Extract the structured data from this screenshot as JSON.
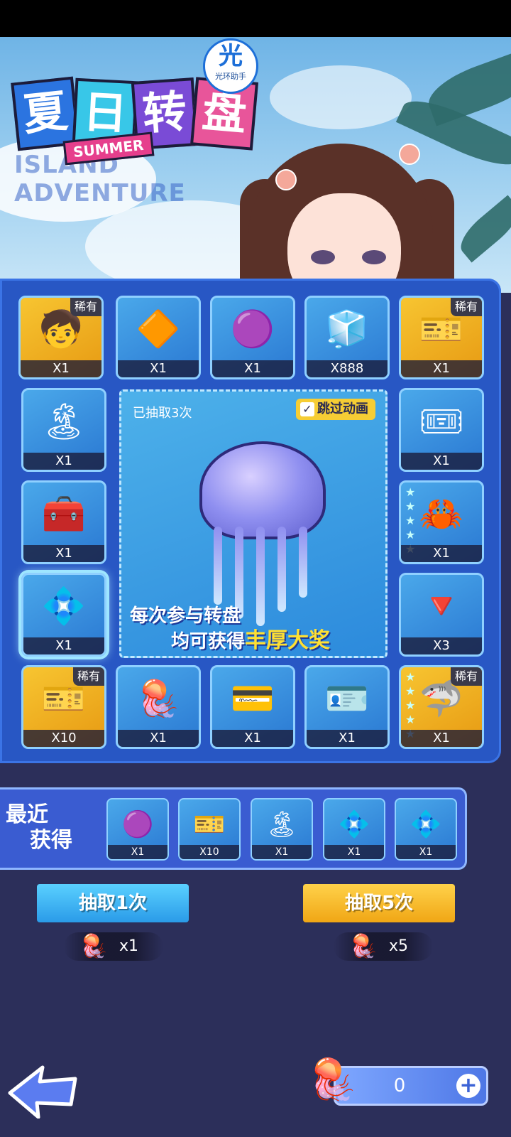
{
  "header": {
    "title_chars": [
      "夏",
      "日",
      "转",
      "盘"
    ],
    "summer_tag": "SUMMER",
    "subtitle": "ISLAND ADVENTURE",
    "helper": {
      "glyph": "光",
      "text": "光环助手"
    }
  },
  "board": {
    "draw_count_text": "已抽取3次",
    "skip_animation": {
      "label": "跳过动画",
      "checked": true,
      "check_mark": "✓"
    },
    "promo_line1": "每次参与转盘",
    "promo_line2_prefix": "均可获得",
    "promo_line2_highlight": "丰厚大奖",
    "rare_label": "稀有",
    "cells": [
      {
        "id": "r1c1",
        "name": "character-portrait",
        "icon": "🧒",
        "qty": "X1",
        "rare": true,
        "stars": 0
      },
      {
        "id": "r1c2",
        "name": "emblem-card",
        "icon": "🔶",
        "qty": "X1",
        "rare": false,
        "stars": 0
      },
      {
        "id": "r1c3",
        "name": "purple-hex-token",
        "icon": "🟣",
        "qty": "X1",
        "rare": false,
        "stars": 0
      },
      {
        "id": "r1c4",
        "name": "blue-cube",
        "icon": "🧊",
        "qty": "X888",
        "rare": false,
        "stars": 0
      },
      {
        "id": "r1c5",
        "name": "unique-ticket",
        "icon": "🎫",
        "qty": "X1",
        "rare": true,
        "stars": 0
      },
      {
        "id": "r2c1",
        "name": "beach-card",
        "icon": "🏝",
        "qty": "X1",
        "rare": false,
        "stars": 0
      },
      {
        "id": "r2c5",
        "name": "unique-ticket-red",
        "icon": "🎟",
        "qty": "X1",
        "rare": false,
        "stars": 0
      },
      {
        "id": "r3c1",
        "name": "red-chest",
        "icon": "🧰",
        "qty": "X1",
        "rare": false,
        "stars": 0
      },
      {
        "id": "r3c5",
        "name": "crab-pet",
        "icon": "🦀",
        "qty": "X1",
        "rare": false,
        "stars": 5
      },
      {
        "id": "r4c1",
        "name": "pink-gem",
        "icon": "💠",
        "qty": "X1",
        "rare": false,
        "stars": 0,
        "selected": true
      },
      {
        "id": "r4c5",
        "name": "triangle-core",
        "icon": "🔻",
        "qty": "X3",
        "rare": false,
        "stars": 0
      },
      {
        "id": "r5c1",
        "name": "gacha-ticket",
        "icon": "🎫",
        "qty": "X10",
        "rare": true,
        "stars": 0
      },
      {
        "id": "r5c2",
        "name": "jellyfish-item",
        "icon": "🪼",
        "qty": "X1",
        "rare": false,
        "stars": 0
      },
      {
        "id": "r5c3",
        "name": "purple-card",
        "icon": "💳",
        "qty": "X1",
        "rare": false,
        "stars": 0
      },
      {
        "id": "r5c4",
        "name": "gold-chip-card",
        "icon": "🪪",
        "qty": "X1",
        "rare": false,
        "stars": 0
      },
      {
        "id": "r5c5",
        "name": "shark-pet",
        "icon": "🦈",
        "qty": "X1",
        "rare": true,
        "stars": 5
      }
    ]
  },
  "recent": {
    "label_line1": "最近",
    "label_line2": "获得",
    "items": [
      {
        "icon": "🟣",
        "qty": "X1"
      },
      {
        "icon": "🎫",
        "qty": "X10"
      },
      {
        "icon": "🏝",
        "qty": "X1"
      },
      {
        "icon": "💠",
        "qty": "X1"
      },
      {
        "icon": "💠",
        "qty": "X1"
      }
    ]
  },
  "actions": {
    "draw_one": {
      "label": "抽取1次",
      "cost": "x1",
      "cost_icon": "🪼"
    },
    "draw_five": {
      "label": "抽取5次",
      "cost": "x5",
      "cost_icon": "🪼"
    }
  },
  "footer": {
    "currency_icon": "🪼",
    "currency_value": "0",
    "add_label": "+"
  },
  "colors": {
    "board": "#2857c4",
    "rare_gold": "#f7c531",
    "accent_blue": "#2a9be8",
    "accent_gold": "#f0a615"
  }
}
